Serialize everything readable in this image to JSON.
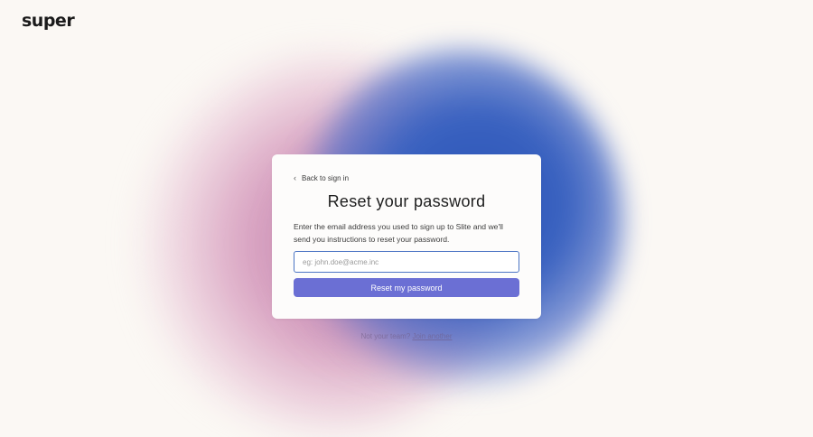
{
  "brand": {
    "logo_text": "super"
  },
  "card": {
    "back_label": "Back to sign in",
    "title": "Reset your password",
    "description": "Enter the email address you used to sign up to Slite and we'll send you instructions to reset your password.",
    "email_placeholder": "eg: john.doe@acme.inc",
    "email_value": "",
    "submit_label": "Reset my password"
  },
  "footer": {
    "prompt": "Not your team?",
    "link_label": "Join another"
  },
  "colors": {
    "background": "#fbf8f4",
    "button": "#6b6fd4",
    "input_border": "#4b74c4",
    "blob_blue": "#2c55b8",
    "blob_pink": "#c98bb0"
  }
}
